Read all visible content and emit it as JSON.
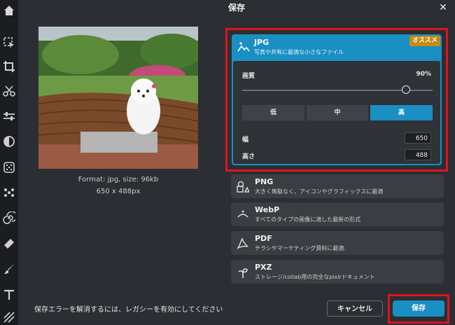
{
  "dialog": {
    "title": "保存",
    "close": "✕"
  },
  "preview": {
    "format_line": "Format: jpg, size: 96kb",
    "dimensions_line": "650 x 488px"
  },
  "toolbar": {
    "icons": [
      "home-icon",
      "select-icon",
      "crop-icon",
      "cut-icon",
      "adjust-icon",
      "filter-icon",
      "effects-icon",
      "retouch-icon",
      "spiral-icon",
      "eraser-icon",
      "brush-icon",
      "text-icon",
      "texture-icon"
    ]
  },
  "formats": {
    "jpg": {
      "title": "JPG",
      "subtitle": "写真や共有に最適な小さなファイル",
      "badge": "オススメ",
      "quality_label": "画質",
      "quality_value": "90%",
      "quality_level": 0.9,
      "levels": [
        "低",
        "中",
        "高"
      ],
      "selected_level": "高",
      "width_label": "幅",
      "width_value": "650",
      "height_label": "高さ",
      "height_value": "488"
    },
    "png": {
      "title": "PNG",
      "subtitle": "大きく無駄なく、アイコンやグラフィックスに最適"
    },
    "webp": {
      "title": "WebP",
      "subtitle": "すべてのタイプの画像に適した最新の形式"
    },
    "pdf": {
      "title": "PDF",
      "subtitle": "チラシやマーケティング資料に最適."
    },
    "pxz": {
      "title": "PXZ",
      "subtitle": "ストレージ/collab用の完全なpixlrドキュメント"
    }
  },
  "footer": {
    "message": "保存エラーを解消するには、レガシーを有効にしてください",
    "cancel_label": "キャンセル",
    "save_label": "保存"
  },
  "colors": {
    "accent": "#1a8fc4",
    "highlight_border": "#e0131d",
    "badge": "#c58a12"
  }
}
